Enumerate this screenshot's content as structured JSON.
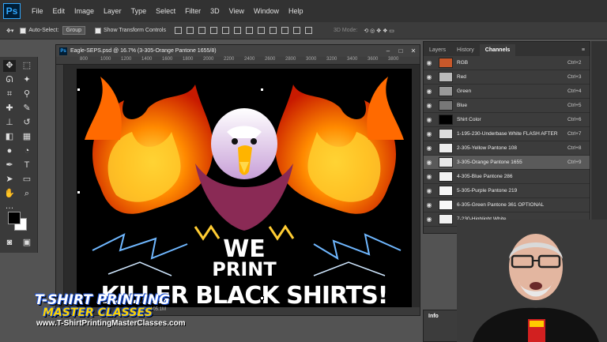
{
  "app": {
    "logo": "Ps"
  },
  "menu": [
    "File",
    "Edit",
    "Image",
    "Layer",
    "Type",
    "Select",
    "Filter",
    "3D",
    "View",
    "Window",
    "Help"
  ],
  "options": {
    "auto_select_label": "Auto-Select:",
    "auto_select_value": "Group",
    "transform_label": "Show Transform Controls",
    "mode_3d": "3D Mode:"
  },
  "document": {
    "tab_title": "Eagle-SEPS.psd @ 16.7% (3-305-Orange Pantone 1655/8)",
    "status": "5.7M/105.1M",
    "ruler_ticks": [
      "800",
      "1000",
      "1200",
      "1400",
      "1600",
      "1800",
      "2000",
      "2200",
      "2400",
      "2600",
      "2800",
      "3000",
      "3200",
      "3400",
      "3600",
      "3800"
    ],
    "art_lines": [
      "WE",
      "PRINT",
      "KILLER BLACK SHIRTS!"
    ]
  },
  "panels": {
    "tabs": [
      "Layers",
      "History",
      "Channels"
    ],
    "active_tab": "Channels",
    "channels": [
      {
        "name": "RGB",
        "shortcut": "Ctrl+2",
        "thumb": "#c8582a"
      },
      {
        "name": "Red",
        "shortcut": "Ctrl+3",
        "thumb": "#bbbbbb"
      },
      {
        "name": "Green",
        "shortcut": "Ctrl+4",
        "thumb": "#999999"
      },
      {
        "name": "Blue",
        "shortcut": "Ctrl+5",
        "thumb": "#777777"
      },
      {
        "name": "Shirt Color",
        "shortcut": "Ctrl+6",
        "thumb": "#000000"
      },
      {
        "name": "1-195-230-Underbase White  FLASH AFTER",
        "shortcut": "Ctrl+7",
        "thumb": "#dddddd"
      },
      {
        "name": "2-305-Yellow Pantone 108",
        "shortcut": "Ctrl+8",
        "thumb": "#eeeeee"
      },
      {
        "name": "3-305-Orange Pantone 1655",
        "shortcut": "Ctrl+9",
        "thumb": "#e8e8e8"
      },
      {
        "name": "4-305-Blue Pantone 286",
        "shortcut": "",
        "thumb": "#f2f2f2"
      },
      {
        "name": "5-305-Purple Pantone 219",
        "shortcut": "",
        "thumb": "#f5f5f5"
      },
      {
        "name": "6-305-Green Pantone 361  OPTIONAL",
        "shortcut": "",
        "thumb": "#f8f8f8"
      },
      {
        "name": "7-230-Highlight White",
        "shortcut": "",
        "thumb": "#f0f0f0"
      }
    ],
    "selected_channel": 7,
    "info_tab": "Info"
  },
  "overlay": {
    "logo_top": "T-SHIRT PRINTING",
    "logo_mid": "MASTER CLASSES",
    "url": "www.T-ShirtPrintingMasterClasses.com"
  },
  "colors": {
    "accent": "#31a8ff",
    "logo_blue": "#1a4fd1",
    "logo_yellow": "#ffd400"
  }
}
